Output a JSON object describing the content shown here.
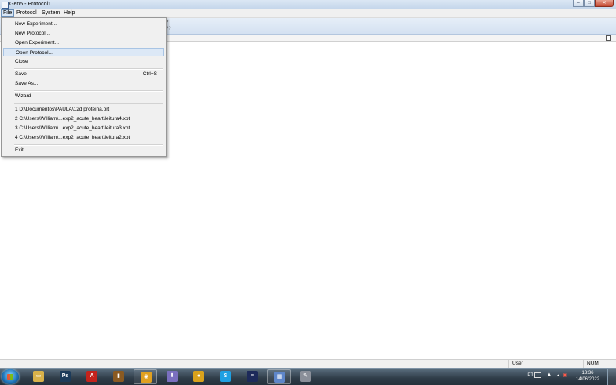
{
  "window": {
    "title": "Gen5 - Protocol1",
    "minimize_glyph": "–",
    "maximize_glyph": "□",
    "close_glyph": "✕"
  },
  "menubar": {
    "items": [
      {
        "label": "File"
      },
      {
        "label": "Protocol"
      },
      {
        "label": "System"
      },
      {
        "label": "Help"
      }
    ]
  },
  "toolbar": {
    "fragment_top": "?",
    "fragment_bottom": "??"
  },
  "file_menu": {
    "new_experiment": "New Experiment...",
    "new_protocol": "New Protocol...",
    "open_experiment": "Open Experiment...",
    "open_protocol": "Open Protocol...",
    "close": "Close",
    "save": "Save",
    "save_shortcut": "Ctrl+S",
    "save_as": "Save As...",
    "wizard": "Wizard",
    "recent": [
      "1 D:\\Documentos\\PAULA\\12d proteina.prt",
      "2 C:\\Users\\William\\...exp2_acute_heart\\leitura4.xpt",
      "3 C:\\Users\\William\\...exp2_acute_heart\\leitura3.xpt",
      "4 C:\\Users\\William\\...exp2_acute_heart\\leitura2.xpt"
    ],
    "exit": "Exit",
    "highlighted": "open_protocol"
  },
  "statusbar": {
    "user": "User",
    "num": "NUM"
  },
  "taskbar": {
    "apps": [
      {
        "icon": "file-explorer-icon",
        "color": "#d9b24a",
        "glyph": "▭"
      },
      {
        "icon": "photoshop-icon",
        "color": "#1c3b5a",
        "glyph": "Ps"
      },
      {
        "icon": "acrobat-icon",
        "color": "#c4231c",
        "glyph": "A"
      },
      {
        "icon": "bottle-app-icon",
        "color": "#8a5a22",
        "glyph": "▮"
      },
      {
        "icon": "media-player-icon",
        "color": "#e0a020",
        "glyph": "◉"
      },
      {
        "icon": "download-arrow-icon",
        "color": "#7a6fbf",
        "glyph": "⬇"
      },
      {
        "icon": "chrome-icon",
        "color": "#d9a21c",
        "glyph": "●"
      },
      {
        "icon": "skype-icon",
        "color": "#1ea0e2",
        "glyph": "S"
      },
      {
        "icon": "scanner-app-icon",
        "color": "#1d2a5a",
        "glyph": "≡"
      },
      {
        "icon": "gen5-app-icon",
        "color": "#5e86c9",
        "glyph": "▦"
      },
      {
        "icon": "paint-app-icon",
        "color": "#8a8f99",
        "glyph": "✎"
      }
    ],
    "tray": {
      "language": "PT",
      "time": "13:36",
      "date": "14/06/2022"
    }
  }
}
